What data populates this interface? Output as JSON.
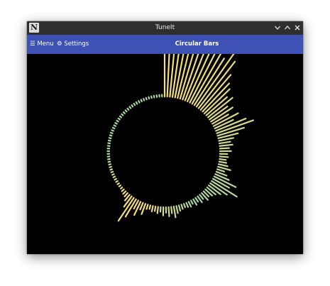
{
  "window": {
    "title": "TuneIt",
    "app_icon_glyph": "N",
    "controls": [
      "minimize-icon",
      "maximize-icon",
      "close-icon"
    ]
  },
  "toolbar": {
    "menu_label": "☰ Menu",
    "settings_label": "⚙ Settings",
    "view_title": "Circular Bars"
  },
  "visualizer": {
    "type": "circular-bars",
    "colors": {
      "yellow": "#f7dd7a",
      "green": "#a9d6a2",
      "background": "#000000"
    },
    "bar_levels": [
      0.58,
      0.83,
      0.75,
      0.88,
      0.7,
      0.8,
      0.6,
      0.72,
      0.55,
      0.92,
      0.68,
      0.78,
      0.6,
      0.86,
      0.64,
      0.5,
      0.42,
      0.38,
      0.3,
      0.34,
      0.24,
      0.28,
      0.2,
      0.3,
      0.22,
      0.35,
      0.42,
      0.3,
      0.22,
      0.16,
      0.12,
      0.14,
      0.1,
      0.12,
      0.08,
      0.09,
      0.07,
      0.08,
      0.1,
      0.14,
      0.08,
      0.12,
      0.16,
      0.26,
      0.2,
      0.32,
      0.22,
      0.16,
      0.12,
      0.1,
      0.08,
      0.1,
      0.06,
      0.08,
      0.05,
      0.07,
      0.04,
      0.06,
      0.05,
      0.04,
      0.05,
      0.06,
      0.08,
      0.12,
      0.07,
      0.1,
      0.06,
      0.09,
      0.05,
      0.07,
      0.05,
      0.06,
      0.04,
      0.05,
      0.12,
      0.08,
      0.16,
      0.1,
      0.22,
      0.3,
      0.14,
      0.08,
      0.05,
      0.04,
      0.03,
      0.02,
      0.02,
      0.02,
      0.02,
      0.02,
      0.02,
      0.02,
      0.02,
      0.02,
      0.02,
      0.02,
      0.02,
      0.02,
      0.02,
      0.02,
      0.02,
      0.02,
      0.02,
      0.02,
      0.02,
      0.02,
      0.02,
      0.02,
      0.02,
      0.02,
      0.02,
      0.02,
      0.02,
      0.02,
      0.02,
      0.02,
      0.02,
      0.02,
      0.02,
      0.02,
      0.02,
      0.02,
      0.02,
      0.02,
      0.02,
      0.02,
      0.02,
      0.02,
      0.02,
      0.02,
      0.02,
      0.02,
      0.02
    ]
  }
}
